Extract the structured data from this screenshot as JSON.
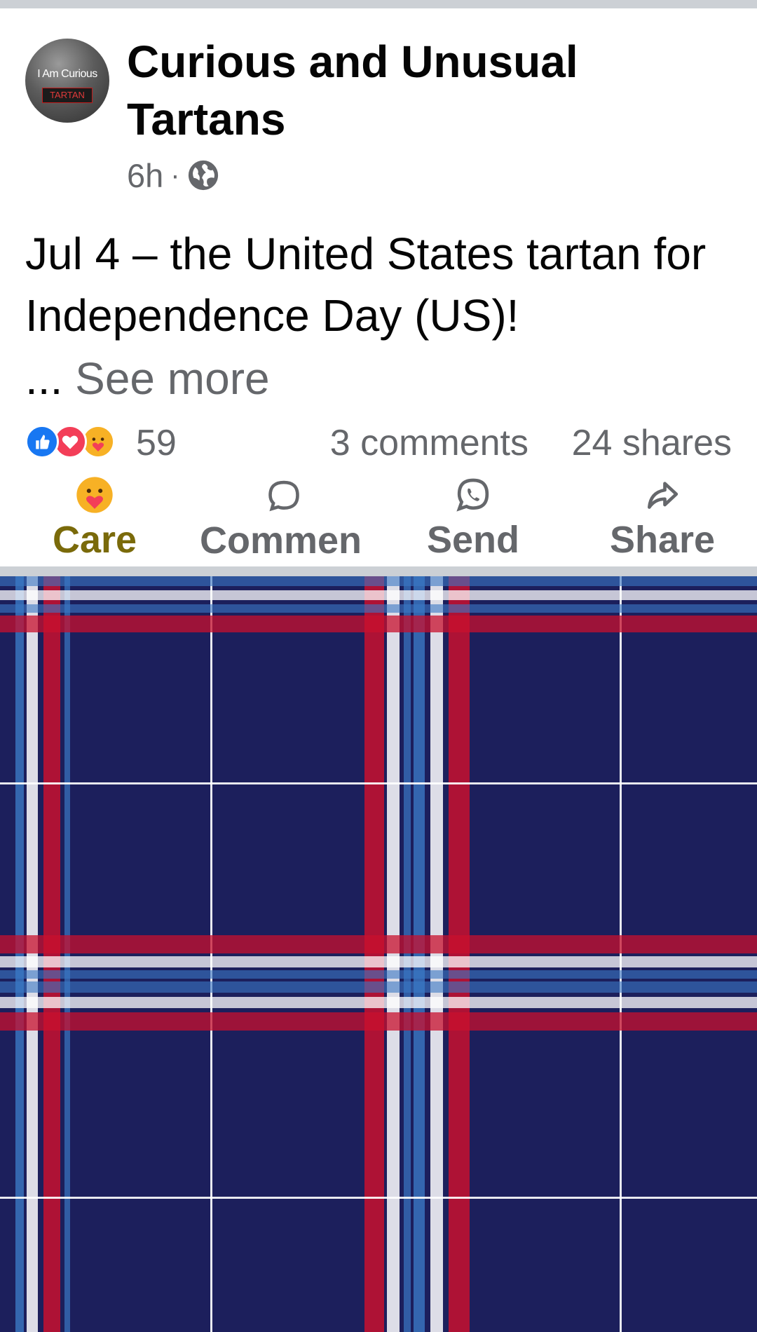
{
  "post": {
    "page_name": "Curious and Unusual Tartans",
    "avatar_text": "I Am Curious",
    "avatar_badge": "TARTAN",
    "time": "6h",
    "separator": "·",
    "audience_icon": "globe-icon",
    "text": "Jul 4 – the United States tartan for Independence Day (US)!",
    "ellipsis": "...",
    "see_more": "See more"
  },
  "stats": {
    "reaction_icons": [
      "like-icon",
      "love-icon",
      "care-icon"
    ],
    "reactions": "59",
    "comments": "3 comments",
    "shares": "24 shares"
  },
  "actions": {
    "care": "Care",
    "comment": "Commen",
    "send": "Send",
    "share": "Share"
  },
  "colors": {
    "tartan_navy": "#1c1f5c",
    "tartan_red": "#c8102e",
    "tartan_white": "#ffffff",
    "tartan_blue": "#3b78c4",
    "care_label": "#7a6a0a"
  }
}
